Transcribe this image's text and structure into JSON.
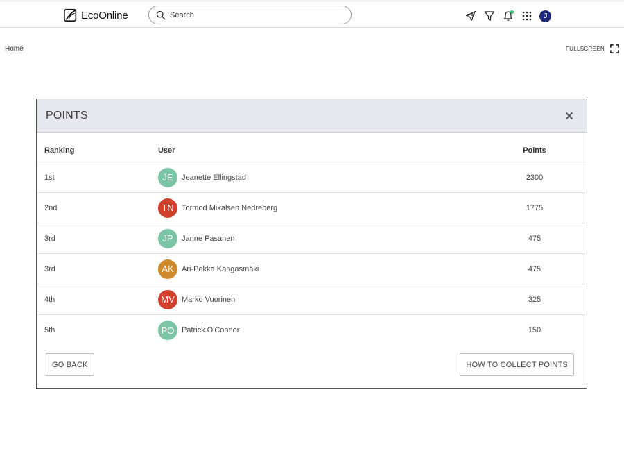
{
  "app": {
    "brand": "EcoOnline"
  },
  "search": {
    "placeholder": "Search"
  },
  "header_icons": [
    "rocket-icon",
    "filter-icon",
    "bell-icon",
    "apps-grid-icon"
  ],
  "user": {
    "initial": "J",
    "color": "#1f2a7a"
  },
  "breadcrumb": {
    "home": "Home"
  },
  "fullscreen": {
    "label": "FULLSCREEN"
  },
  "modal": {
    "title": "POINTS",
    "columns": {
      "ranking": "Ranking",
      "user": "User",
      "points": "Points"
    },
    "rows": [
      {
        "rank": "1st",
        "initials": "JE",
        "name": "Jeanette Ellingstad",
        "points": "2300",
        "color": "#7cc4a6"
      },
      {
        "rank": "2nd",
        "initials": "TN",
        "name": "Tormod Mikalsen Nedreberg",
        "points": "1775",
        "color": "#d1402b"
      },
      {
        "rank": "3rd",
        "initials": "JP",
        "name": "Janne Pasanen",
        "points": "475",
        "color": "#7cc4a6"
      },
      {
        "rank": "3rd",
        "initials": "AK",
        "name": "Ari-Pekka Kangasmäki",
        "points": "475",
        "color": "#d08a2e"
      },
      {
        "rank": "4th",
        "initials": "MV",
        "name": "Marko Vuorinen",
        "points": "325",
        "color": "#d1402b"
      },
      {
        "rank": "5th",
        "initials": "PO",
        "name": "Patrick O'Connor",
        "points": "150",
        "color": "#7cc4a6"
      }
    ],
    "buttons": {
      "back": "GO BACK",
      "how": "HOW TO COLLECT POINTS"
    }
  }
}
